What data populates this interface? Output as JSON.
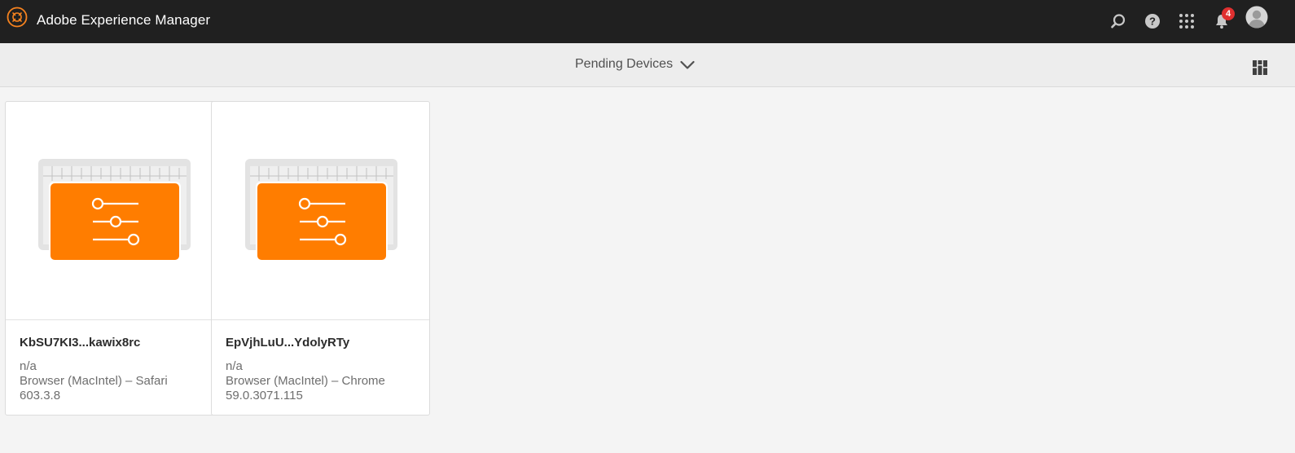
{
  "shell": {
    "app_title": "Adobe Experience Manager",
    "notification_count": "4",
    "icons": [
      "adobe-experience-logo-icon",
      "search-icon",
      "help-icon",
      "solutions-grid-icon",
      "bell-icon",
      "user-avatar-icon"
    ]
  },
  "header": {
    "title": "Pending Devices",
    "view_icon": "card-view-icon"
  },
  "devices": [
    {
      "name": "KbSU7KI3...kawix8rc",
      "location": "n/a",
      "details_line1": "Browser (MacIntel) – Safari",
      "details_line2": "603.3.8"
    },
    {
      "name": "EpVjhLuU...YdolyRTy",
      "location": "n/a",
      "details_line1": "Browser (MacIntel) – Chrome",
      "details_line2": "59.0.3071.115"
    }
  ],
  "colors": {
    "shell_bg": "#202020",
    "accent_orange": "#ff7d00",
    "badge_red": "#e03030",
    "page_bg": "#f4f4f4"
  }
}
